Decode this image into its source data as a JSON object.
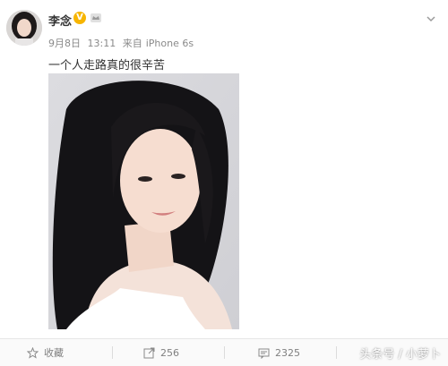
{
  "user": {
    "name": "李念",
    "verified_badge": "V",
    "avatar_icon": "avatar",
    "member_icon": "crown-icon"
  },
  "meta": {
    "date": "9月8日",
    "time": "13:11",
    "source_prefix": "来自",
    "source": "iPhone 6s"
  },
  "post": {
    "text": "一个人走路真的很辛苦"
  },
  "actions": {
    "favorite_label": "收藏",
    "repost_count": "256",
    "comment_count": "2325"
  },
  "watermark": "头条号 / 小萝卜",
  "colors": {
    "verified": "#f7b500",
    "text": "#333333",
    "meta": "#8a8a8a"
  }
}
